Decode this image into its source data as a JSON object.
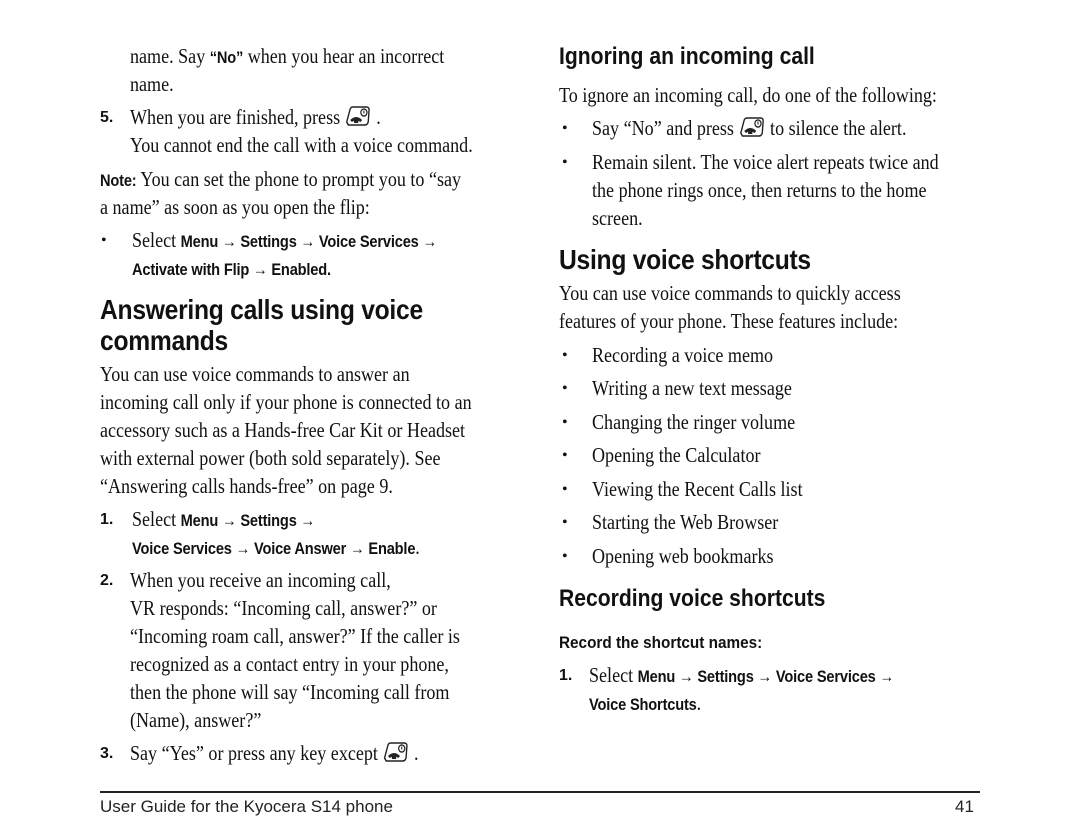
{
  "left_column": {
    "continued_step": {
      "line1_pre": "name. Say ",
      "line1_bold": "“No”",
      "line1_post": " when you hear an incorrect",
      "line2": "name."
    },
    "step5": {
      "number": "5.",
      "text_pre": "When you are finished, press",
      "text_post": ".",
      "icon": "end-key-icon",
      "line2": "You cannot end the call with a voice command."
    },
    "note": {
      "label": "Note:",
      "line1": " You can set the phone to prompt you to “say",
      "line2": "a name” as soon as you open the flip:"
    },
    "note_bullet": {
      "bullet": "•",
      "select": "Select ",
      "path_line1": "Menu → Settings → Voice Services →",
      "path_line2": "Activate with Flip → Enabled."
    },
    "section_title_line1": "Answering calls using voice",
    "section_title_line2": "commands",
    "intro_lines": [
      "You can use voice commands to answer an",
      "incoming call only if your phone is connected to an",
      "accessory such as a Hands-free Car Kit or Headset",
      "with external power (both sold separately). See",
      "“Answering calls hands-free” on page 9."
    ],
    "steps": [
      {
        "number": "1.",
        "select": "Select ",
        "path_line1": "Menu → Settings →",
        "path_line2": "Voice Services → Voice Answer → Enable",
        "period": "."
      },
      {
        "number": "2.",
        "lines": [
          "When you receive an incoming call,",
          "VR responds: “Incoming call, answer?” or",
          "“Incoming roam call, answer?” If the caller is",
          "recognized as a contact entry in your phone,",
          "then the phone will say “Incoming call from",
          "(Name), answer?”"
        ]
      },
      {
        "number": "3.",
        "text_pre": "Say “Yes” or press any key except",
        "text_post": ".",
        "icon": "end-key-icon"
      }
    ]
  },
  "right_column": {
    "ignoring": {
      "title": "Ignoring an incoming call",
      "intro": "To ignore an incoming call, do one of the following:",
      "bullets": [
        {
          "pre": "Say “No” and press",
          "post": "to silence the alert.",
          "icon": "end-key-icon"
        },
        {
          "lines": [
            "Remain silent. The voice alert repeats twice and",
            "the phone rings once, then returns to the home",
            "screen."
          ]
        }
      ]
    },
    "shortcuts": {
      "title": "Using voice shortcuts",
      "intro_lines": [
        "You can use voice commands to quickly access",
        "features of your phone. These features include:"
      ],
      "features": [
        "Recording a voice memo",
        "Writing a new text message",
        "Changing the ringer volume",
        "Opening the Calculator",
        "Viewing the Recent Calls list",
        "Starting the Web Browser",
        "Opening web bookmarks"
      ]
    },
    "recording": {
      "title": "Recording voice shortcuts",
      "subtitle": "Record the shortcut names:",
      "step1": {
        "number": "1.",
        "select": "Select ",
        "path_line1": "Menu → Settings → Voice Services →",
        "path_line2": "Voice Shortcuts",
        "period": "."
      }
    }
  },
  "footer": {
    "title": "User Guide for the Kyocera S14 phone",
    "page_number": "41"
  }
}
